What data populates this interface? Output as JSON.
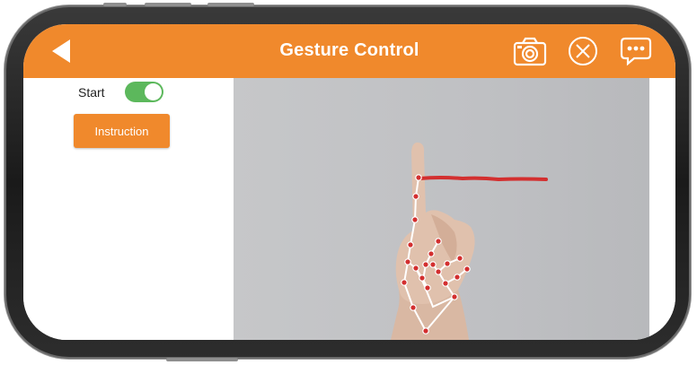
{
  "app_bar": {
    "title": "Gesture Control",
    "back_icon": "back-arrow-icon",
    "camera_icon": "camera-icon",
    "close_icon": "close-circle-icon",
    "chat_icon": "chat-bubble-icon",
    "color": "#f0892c"
  },
  "controls": {
    "start_label": "Start",
    "start_toggle_on": true,
    "toggle_color": "#5cb85c",
    "instruction_label": "Instruction"
  },
  "camera_view": {
    "landmark_color": "#d32f2f",
    "drawn_stroke_color": "#d32f2f",
    "skeleton_color": "#ffffff"
  }
}
